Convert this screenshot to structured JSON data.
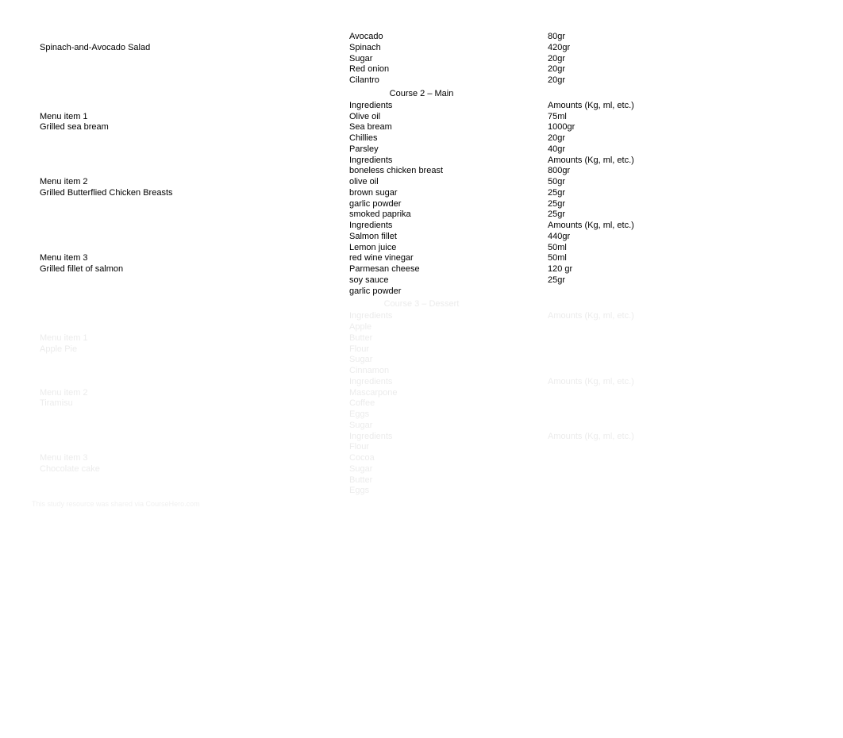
{
  "top_item": {
    "name": "Spinach-and-Avocado Salad",
    "rows": [
      {
        "ing": "Avocado",
        "amt": "80gr"
      },
      {
        "ing": "Spinach",
        "amt": "420gr"
      },
      {
        "ing": "Sugar",
        "amt": "20gr"
      },
      {
        "ing": "Red onion",
        "amt": "20gr"
      },
      {
        "ing": "Cilantro",
        "amt": "20gr"
      }
    ]
  },
  "course2": {
    "header": "Course 2 – Main",
    "items": [
      {
        "label": "Menu item 1",
        "name": "Grilled sea bream",
        "ing_header": "Ingredients",
        "amt_header": "Amounts (Kg, ml, etc.)",
        "rows": [
          {
            "ing": "Olive oil",
            "amt": "75ml"
          },
          {
            "ing": "Sea bream",
            "amt": "1000gr"
          },
          {
            "ing": "Chillies",
            "amt": "20gr"
          },
          {
            "ing": "Parsley",
            "amt": "40gr"
          }
        ]
      },
      {
        "label": "Menu item 2",
        "name": "Grilled Butterflied Chicken Breasts",
        "ing_header": "Ingredients",
        "amt_header": "Amounts (Kg, ml, etc.)",
        "rows": [
          {
            "ing": "boneless chicken breast",
            "amt": "800gr"
          },
          {
            "ing": "olive oil",
            "amt": "50gr"
          },
          {
            "ing": "brown sugar",
            "amt": "25gr"
          },
          {
            "ing": "garlic powder",
            "amt": "25gr"
          },
          {
            "ing": "smoked paprika",
            "amt": "25gr"
          }
        ]
      },
      {
        "label": "Menu item 3",
        "name": "Grilled fillet of salmon",
        "ing_header": "Ingredients",
        "amt_header": "Amounts (Kg, ml, etc.)",
        "rows": [
          {
            "ing": "Salmon fillet",
            "amt": "440gr"
          },
          {
            "ing": "Lemon juice",
            "amt": "50ml"
          },
          {
            "ing": "red wine vinegar",
            "amt": "50ml"
          },
          {
            "ing": "Parmesan cheese",
            "amt": "120 gr"
          },
          {
            "ing": "soy sauce",
            "amt": "25gr"
          },
          {
            "ing": "garlic powder",
            "amt": ""
          }
        ]
      }
    ]
  },
  "course3": {
    "header": "Course 3 – Dessert",
    "items": [
      {
        "label": "Menu item 1",
        "name": "Apple Pie",
        "ing_header": "Ingredients",
        "amt_header": "Amounts (Kg, ml, etc.)",
        "rows": [
          {
            "ing": "Apple",
            "amt": ""
          },
          {
            "ing": "Butter",
            "amt": ""
          },
          {
            "ing": "Flour",
            "amt": ""
          },
          {
            "ing": "Sugar",
            "amt": ""
          },
          {
            "ing": "Cinnamon",
            "amt": ""
          }
        ]
      },
      {
        "label": "Menu item 2",
        "name": "Tiramisu",
        "ing_header": "Ingredients",
        "amt_header": "Amounts (Kg, ml, etc.)",
        "rows": [
          {
            "ing": "Mascarpone",
            "amt": ""
          },
          {
            "ing": "Coffee",
            "amt": ""
          },
          {
            "ing": "Eggs",
            "amt": ""
          },
          {
            "ing": "Sugar",
            "amt": ""
          }
        ]
      },
      {
        "label": "Menu item 3",
        "name": "Chocolate cake",
        "ing_header": "Ingredients",
        "amt_header": "Amounts (Kg, ml, etc.)",
        "rows": [
          {
            "ing": "Flour",
            "amt": ""
          },
          {
            "ing": "Cocoa",
            "amt": ""
          },
          {
            "ing": "Sugar",
            "amt": ""
          },
          {
            "ing": "Butter",
            "amt": ""
          },
          {
            "ing": "Eggs",
            "amt": ""
          }
        ]
      }
    ]
  },
  "footer": "This study resource was shared via CourseHero.com"
}
